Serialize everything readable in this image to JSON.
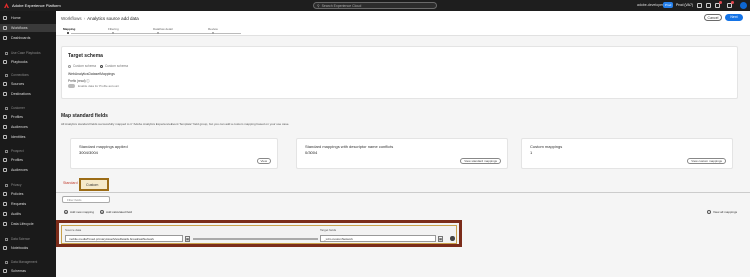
{
  "topbar": {
    "brand": "Adobe Experience Platform",
    "search_placeholder": "Search Experience Cloud",
    "org": "adobe-developer",
    "sandbox_pill": "Prod",
    "sandbox_name": "Prod (VA7)"
  },
  "sidebar": {
    "items": [
      {
        "label": "Home"
      },
      {
        "label": "Workflows"
      },
      {
        "label": "Dashboards"
      }
    ],
    "sections": [
      {
        "label": "Use Case Playbooks"
      },
      {
        "label": "Connections"
      },
      {
        "label": "Customer"
      },
      {
        "label": "Prospect"
      },
      {
        "label": "Privacy"
      },
      {
        "label": "Data Science"
      },
      {
        "label": "Data Management"
      }
    ],
    "items2": [
      {
        "label": "Playbooks"
      },
      {
        "label": "Sources"
      },
      {
        "label": "Destinations"
      },
      {
        "label": "Profiles"
      },
      {
        "label": "Audiences"
      },
      {
        "label": "Identities"
      },
      {
        "label": "Profiles"
      },
      {
        "label": "Audiences"
      },
      {
        "label": "Policies"
      },
      {
        "label": "Requests"
      },
      {
        "label": "Audits"
      },
      {
        "label": "Data Lifecycle"
      },
      {
        "label": "Notebooks"
      },
      {
        "label": "Schemas"
      }
    ]
  },
  "header": {
    "breadcrumb_root": "Workflows",
    "breadcrumb_current": "Analytics source add data",
    "steps": [
      "Mapping",
      "Filtering",
      "Dataflow detail",
      "Review"
    ],
    "cancel_label": "Cancel",
    "next_label": "Next"
  },
  "target_schema": {
    "title": "Target schema",
    "option_existing": "Custom schema",
    "option_default": "Custom schema",
    "schema_name": "WebAnalyticsDatasetMappings",
    "prefix": "Prefix (read) ⓘ",
    "toggle_label": "Enable data for Profile account"
  },
  "map_standard": {
    "title": "Map standard fields",
    "description": "All Analytics standard fields successfully mapped to it \"Adobe Analytics ExperienceEvent Template\" field group, but you can add a custom mapping based on your use case.",
    "cards": [
      {
        "title": "Standard mappings applied",
        "value": "3004/3004",
        "button": "View"
      },
      {
        "title": "Standard mappings with descriptor name conflicts",
        "value": "0/3004",
        "button": "View standard mappings"
      },
      {
        "title": "Custom mappings",
        "value": "1",
        "button": "View custom mappings"
      }
    ]
  },
  "tabs": {
    "standard": "Standard",
    "custom": "Custom"
  },
  "filter_placeholder": "Filter fields",
  "actions": {
    "add_mapping": "Add new mapping",
    "add_calc": "Add calculated field",
    "view_all": "View all mappings"
  },
  "mapping_row": {
    "source_label": "Source data",
    "source_value": "mobile.mediaTimed.primaryAssetViewDetails.broadcastNetwork",
    "target_label": "Target fields",
    "target_value": "_xdm.customNetwork"
  },
  "colors": {
    "accent": "#1473e6",
    "highlight_border": "#7b2c1a",
    "tab_highlight": "#9c6c16"
  }
}
